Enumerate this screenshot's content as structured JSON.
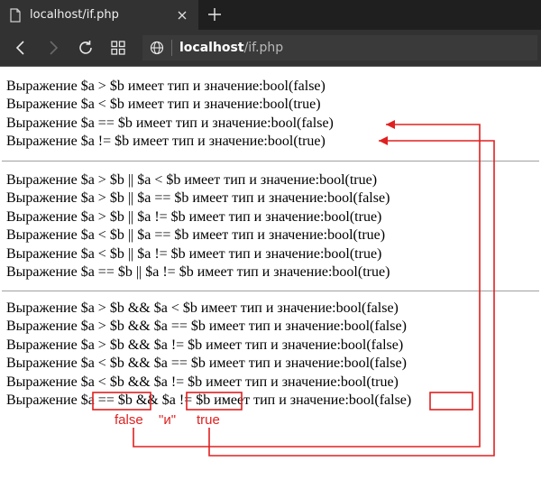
{
  "browser": {
    "tab_title": "localhost/if.php",
    "url_host": "localhost",
    "url_path": "/if.php"
  },
  "page": {
    "group1": [
      "Выражение $a > $b имеет тип и значение:bool(false)",
      "Выражение $a < $b имеет тип и значение:bool(true)",
      "Выражение $a == $b имеет тип и значение:bool(false)",
      "Выражение $a != $b имеет тип и значение:bool(true)"
    ],
    "group2": [
      "Выражение $a > $b || $a < $b имеет тип и значение:bool(true)",
      "Выражение $a > $b || $a == $b имеет тип и значение:bool(false)",
      "Выражение $a > $b || $a != $b имеет тип и значение:bool(true)",
      "Выражение $a < $b || $a == $b имеет тип и значение:bool(true)",
      "Выражение $a < $b || $a != $b имеет тип и значение:bool(true)",
      "Выражение $a == $b || $a != $b имеет тип и значение:bool(true)"
    ],
    "group3": [
      "Выражение $a > $b && $a < $b имеет тип и значение:bool(false)",
      "Выражение $a > $b && $a == $b имеет тип и значение:bool(false)",
      "Выражение $a > $b && $a != $b имеет тип и значение:bool(false)",
      "Выражение $a < $b && $a == $b имеет тип и значение:bool(false)",
      "Выражение $a < $b && $a != $b имеет тип и значение:bool(true)",
      "Выражение $a == $b && $a != $b имеет тип и значение:bool(false)"
    ]
  },
  "annotations": {
    "label_left": "false",
    "label_mid": "\"и\"",
    "label_right": "true",
    "color": "#e02020"
  }
}
